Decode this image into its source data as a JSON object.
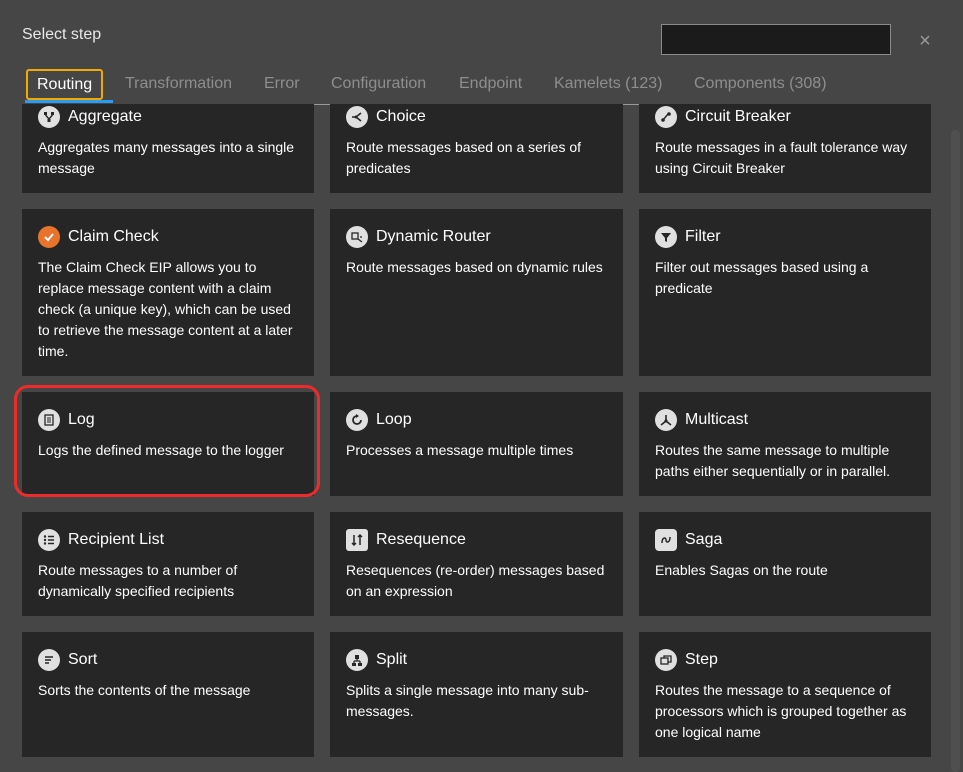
{
  "dialog": {
    "title": "Select step",
    "search_value": "",
    "close_symbol": "×"
  },
  "tabs": [
    {
      "label": "Routing",
      "active": true
    },
    {
      "label": "Transformation"
    },
    {
      "label": "Error"
    },
    {
      "label": "Configuration"
    },
    {
      "label": "Endpoint"
    },
    {
      "label": "Kamelets (123)"
    },
    {
      "label": "Components (308)"
    }
  ],
  "cards": [
    {
      "title": "Aggregate",
      "icon": "aggregate-icon",
      "description": "Aggregates many messages into a single message"
    },
    {
      "title": "Choice",
      "icon": "choice-icon",
      "description": "Route messages based on a series of predicates"
    },
    {
      "title": "Circuit Breaker",
      "icon": "circuit-breaker-icon",
      "description": "Route messages in a fault tolerance way using Circuit Breaker"
    },
    {
      "title": "Claim Check",
      "icon": "claim-check-icon",
      "description": "The Claim Check EIP allows you to replace message content with a claim check (a unique key), which can be used to retrieve the message content at a later time."
    },
    {
      "title": "Dynamic Router",
      "icon": "dynamic-router-icon",
      "description": "Route messages based on dynamic rules"
    },
    {
      "title": "Filter",
      "icon": "filter-icon",
      "description": "Filter out messages based using a predicate"
    },
    {
      "title": "Log",
      "icon": "log-icon",
      "description": "Logs the defined message to the logger"
    },
    {
      "title": "Loop",
      "icon": "loop-icon",
      "description": "Processes a message multiple times"
    },
    {
      "title": "Multicast",
      "icon": "multicast-icon",
      "description": "Routes the same message to multiple paths either sequentially or in parallel."
    },
    {
      "title": "Recipient List",
      "icon": "recipient-list-icon",
      "description": "Route messages to a number of dynamically specified recipients"
    },
    {
      "title": "Resequence",
      "icon": "resequence-icon",
      "description": "Resequences (re-order) messages based on an expression"
    },
    {
      "title": "Saga",
      "icon": "saga-icon",
      "description": "Enables Sagas on the route"
    },
    {
      "title": "Sort",
      "icon": "sort-icon",
      "description": "Sorts the contents of the message"
    },
    {
      "title": "Split",
      "icon": "split-icon",
      "description": "Splits a single message into many sub-messages."
    },
    {
      "title": "Step",
      "icon": "step-icon",
      "description": "Routes the message to a sequence of processors which is grouped together as one logical name"
    }
  ],
  "colors": {
    "background": "#464646",
    "card": "#262626",
    "active_tab_border": "#f0ab00",
    "active_tab_underline": "#2b9af3",
    "highlight": "#ee2b2b",
    "claim_check_icon": "#e8742c"
  }
}
